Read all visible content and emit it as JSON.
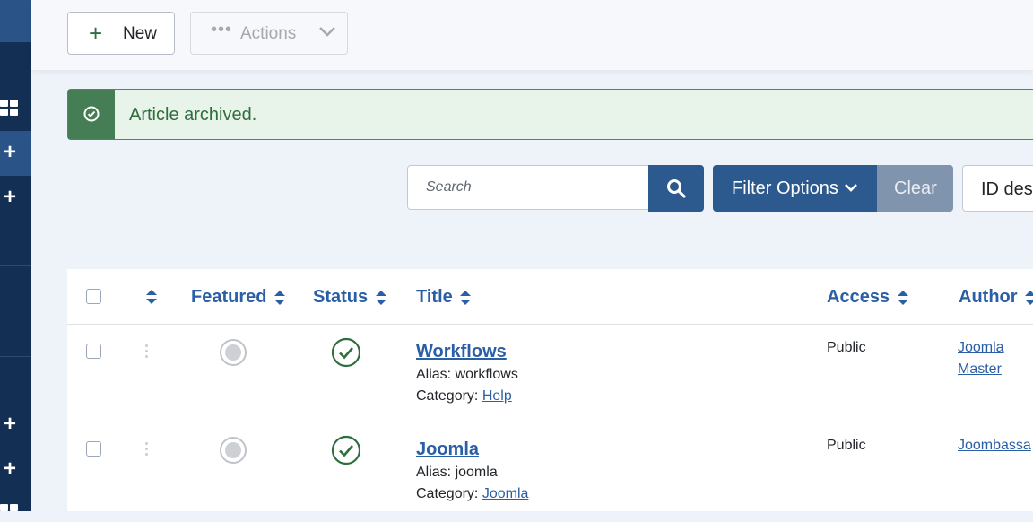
{
  "toolbar": {
    "new_label": "New",
    "actions_label": "Actions"
  },
  "alert": {
    "message": "Article archived."
  },
  "filters": {
    "search_placeholder": "Search",
    "filter_options_label": "Filter Options",
    "clear_label": "Clear",
    "sort_label": "ID desc"
  },
  "table": {
    "headers": {
      "featured": "Featured",
      "status": "Status",
      "title": "Title",
      "access": "Access",
      "author": "Author"
    },
    "rows": [
      {
        "title": "Workflows",
        "alias_label": "Alias:",
        "alias": "workflows",
        "category_label": "Category:",
        "category": "Help",
        "access": "Public",
        "author_line1": "Joomla",
        "author_line2": "Master"
      },
      {
        "title": "Joomla",
        "alias_label": "Alias:",
        "alias": "joomla",
        "category_label": "Category:",
        "category": "Joomla",
        "access": "Public",
        "author_line1": "Joombassa",
        "author_line2": ""
      }
    ]
  },
  "colors": {
    "sidebar": "#132f53",
    "primary": "#2d5a8e",
    "success": "#457d54",
    "link": "#2a5fa6"
  }
}
